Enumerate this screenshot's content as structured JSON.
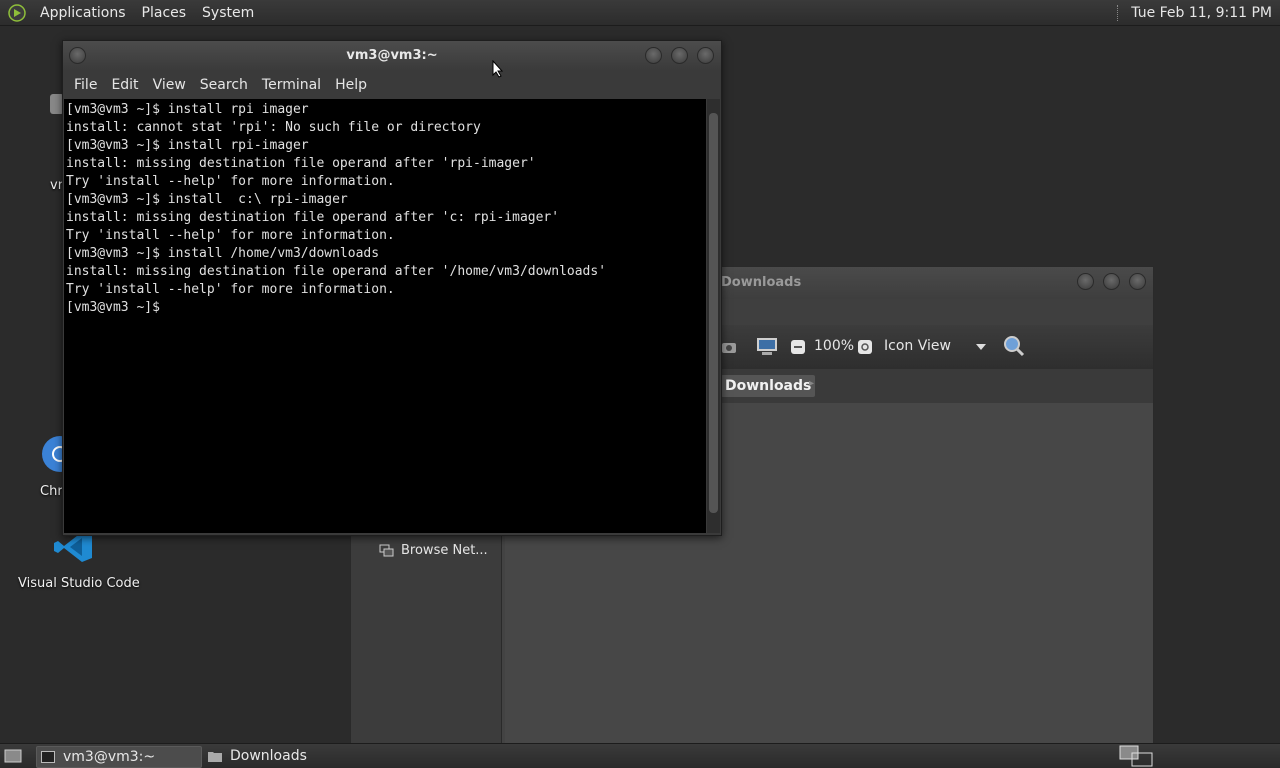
{
  "top_panel": {
    "menus": [
      "Applications",
      "Places",
      "System"
    ],
    "clock": "Tue Feb 11,  9:11 PM"
  },
  "desktop": {
    "icons": [
      {
        "label": "vn",
        "icon": "computer-icon"
      },
      {
        "label": "Chr",
        "icon": "chrome-icon"
      },
      {
        "label": "Visual Studio Code",
        "icon": "vscode-icon"
      }
    ]
  },
  "terminal": {
    "title": "vm3@vm3:~",
    "menu": [
      "File",
      "Edit",
      "View",
      "Search",
      "Terminal",
      "Help"
    ],
    "lines": [
      "[vm3@vm3 ~]$ install rpi imager",
      "install: cannot stat 'rpi': No such file or directory",
      "[vm3@vm3 ~]$ install rpi-imager",
      "install: missing destination file operand after 'rpi-imager'",
      "Try 'install --help' for more information.",
      "[vm3@vm3 ~]$ install  c:\\ rpi-imager",
      "install: missing destination file operand after 'c: rpi-imager'",
      "Try 'install --help' for more information.",
      "[vm3@vm3 ~]$ install /home/vm3/downloads",
      "install: missing destination file operand after '/home/vm3/downloads'",
      "Try 'install --help' for more information.",
      "[vm3@vm3 ~]$ "
    ]
  },
  "file_manager": {
    "title": "Downloads",
    "zoom": "100%",
    "view_mode": "Icon View",
    "breadcrumb": "Downloads",
    "sidebar_item": "Browse Net..."
  },
  "taskbar": {
    "tasks": [
      "vm3@vm3:~",
      "Downloads"
    ]
  }
}
